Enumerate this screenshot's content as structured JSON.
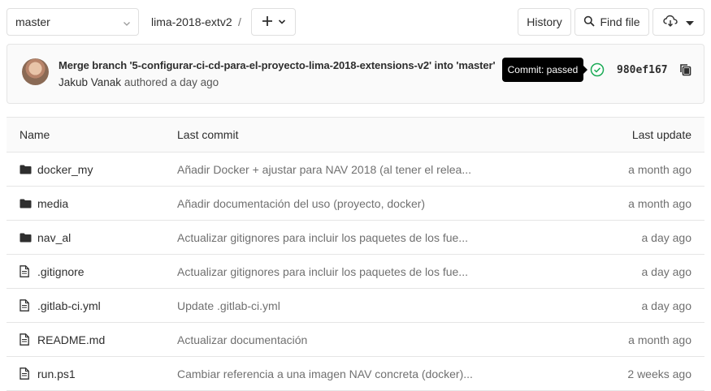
{
  "toolbar": {
    "branch": "master",
    "project_path": "lima-2018-extv2",
    "path_separator": "/",
    "history_label": "History",
    "find_file_label": "Find file"
  },
  "commit": {
    "title": "Merge branch '5-configurar-ci-cd-para-el-proyecto-lima-2018-extensions-v2' into 'master'",
    "author": "Jakub Vanak",
    "authored": "authored a day ago",
    "tooltip": "Commit: passed",
    "sha": "980ef167",
    "status_color": "#1aaa55"
  },
  "table": {
    "headers": {
      "name": "Name",
      "last_commit": "Last commit",
      "last_update": "Last update"
    },
    "rows": [
      {
        "type": "folder",
        "icon": "folder-icon",
        "name": "docker_my",
        "commit": "Añadir Docker + ajustar para NAV 2018 (al tener el relea...",
        "updated": "a month ago"
      },
      {
        "type": "folder",
        "icon": "folder-icon",
        "name": "media",
        "commit": "Añadir documentación del uso (proyecto, docker)",
        "updated": "a month ago"
      },
      {
        "type": "folder",
        "icon": "folder-icon",
        "name": "nav_al",
        "commit": "Actualizar gitignores para incluir los paquetes de los fue...",
        "updated": "a day ago"
      },
      {
        "type": "file",
        "icon": "file-icon",
        "name": ".gitignore",
        "commit": "Actualizar gitignores para incluir los paquetes de los fue...",
        "updated": "a day ago"
      },
      {
        "type": "file",
        "icon": "file-icon",
        "name": ".gitlab-ci.yml",
        "commit": "Update .gitlab-ci.yml",
        "updated": "a day ago"
      },
      {
        "type": "file",
        "icon": "file-icon",
        "name": "README.md",
        "commit": "Actualizar documentación",
        "updated": "a month ago"
      },
      {
        "type": "file",
        "icon": "file-icon",
        "name": "run.ps1",
        "commit": "Cambiar referencia a una imagen NAV concreta (docker)...",
        "updated": "2 weeks ago"
      }
    ]
  }
}
